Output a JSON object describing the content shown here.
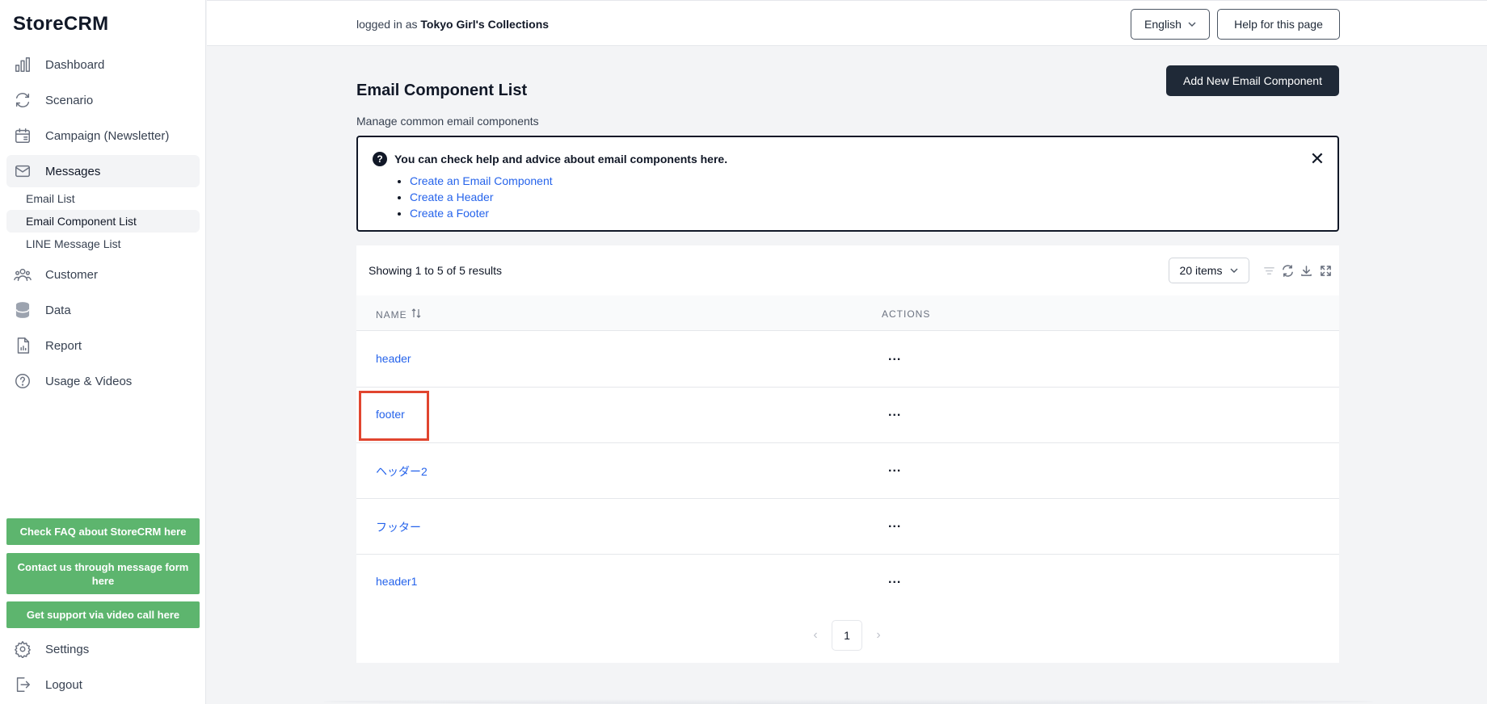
{
  "brand": "StoreCRM",
  "sidebar": {
    "items": [
      {
        "label": "Dashboard",
        "icon": "bar-chart-icon"
      },
      {
        "label": "Scenario",
        "icon": "refresh-icon"
      },
      {
        "label": "Campaign (Newsletter)",
        "icon": "calendar-icon"
      },
      {
        "label": "Messages",
        "icon": "envelope-icon"
      },
      {
        "label": "Customer",
        "icon": "users-icon"
      },
      {
        "label": "Data",
        "icon": "database-icon"
      },
      {
        "label": "Report",
        "icon": "document-chart-icon"
      },
      {
        "label": "Usage & Videos",
        "icon": "question-circle-icon"
      }
    ],
    "sub_items": [
      "Email List",
      "Email Component List",
      "LINE Message List"
    ],
    "support_buttons": [
      "Check FAQ about StoreCRM here",
      "Contact us through message form here",
      "Get support via video call here"
    ],
    "settings": "Settings",
    "logout": "Logout"
  },
  "topbar": {
    "logged_prefix": "logged in as",
    "account": "Tokyo Girl's Collections",
    "language": "English",
    "help": "Help for this page"
  },
  "main": {
    "title": "Email Component List",
    "subtitle": "Manage common email components",
    "add_button": "Add New Email Component",
    "info": {
      "heading": "You can check help and advice about email components here.",
      "links": [
        "Create an Email Component",
        "Create a Header",
        "Create a Footer"
      ]
    },
    "table": {
      "showing": "Showing 1 to 5 of 5 results",
      "page_size": "20 items",
      "columns": [
        "NAME",
        "ACTIONS"
      ],
      "rows": [
        {
          "name": "header",
          "actions": "..."
        },
        {
          "name": "footer",
          "actions": "..."
        },
        {
          "name": "ヘッダー2",
          "actions": "..."
        },
        {
          "name": "フッター",
          "actions": "..."
        },
        {
          "name": "header1",
          "actions": "..."
        }
      ],
      "page": "1"
    }
  },
  "colors": {
    "support_green": "#5db56e",
    "primary_dark": "#1f2937",
    "link_blue": "#2563eb",
    "highlight_red": "#e1452f"
  }
}
